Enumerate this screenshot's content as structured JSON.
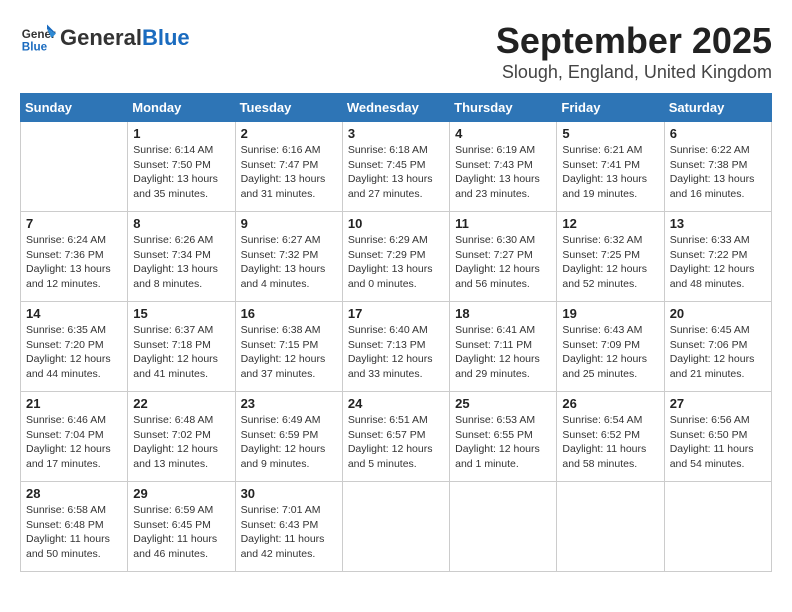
{
  "logo": {
    "general": "General",
    "blue": "Blue"
  },
  "title": "September 2025",
  "subtitle": "Slough, England, United Kingdom",
  "days": [
    "Sunday",
    "Monday",
    "Tuesday",
    "Wednesday",
    "Thursday",
    "Friday",
    "Saturday"
  ],
  "weeks": [
    [
      {
        "date": "",
        "info": ""
      },
      {
        "date": "1",
        "info": "Sunrise: 6:14 AM\nSunset: 7:50 PM\nDaylight: 13 hours\nand 35 minutes."
      },
      {
        "date": "2",
        "info": "Sunrise: 6:16 AM\nSunset: 7:47 PM\nDaylight: 13 hours\nand 31 minutes."
      },
      {
        "date": "3",
        "info": "Sunrise: 6:18 AM\nSunset: 7:45 PM\nDaylight: 13 hours\nand 27 minutes."
      },
      {
        "date": "4",
        "info": "Sunrise: 6:19 AM\nSunset: 7:43 PM\nDaylight: 13 hours\nand 23 minutes."
      },
      {
        "date": "5",
        "info": "Sunrise: 6:21 AM\nSunset: 7:41 PM\nDaylight: 13 hours\nand 19 minutes."
      },
      {
        "date": "6",
        "info": "Sunrise: 6:22 AM\nSunset: 7:38 PM\nDaylight: 13 hours\nand 16 minutes."
      }
    ],
    [
      {
        "date": "7",
        "info": "Sunrise: 6:24 AM\nSunset: 7:36 PM\nDaylight: 13 hours\nand 12 minutes."
      },
      {
        "date": "8",
        "info": "Sunrise: 6:26 AM\nSunset: 7:34 PM\nDaylight: 13 hours\nand 8 minutes."
      },
      {
        "date": "9",
        "info": "Sunrise: 6:27 AM\nSunset: 7:32 PM\nDaylight: 13 hours\nand 4 minutes."
      },
      {
        "date": "10",
        "info": "Sunrise: 6:29 AM\nSunset: 7:29 PM\nDaylight: 13 hours\nand 0 minutes."
      },
      {
        "date": "11",
        "info": "Sunrise: 6:30 AM\nSunset: 7:27 PM\nDaylight: 12 hours\nand 56 minutes."
      },
      {
        "date": "12",
        "info": "Sunrise: 6:32 AM\nSunset: 7:25 PM\nDaylight: 12 hours\nand 52 minutes."
      },
      {
        "date": "13",
        "info": "Sunrise: 6:33 AM\nSunset: 7:22 PM\nDaylight: 12 hours\nand 48 minutes."
      }
    ],
    [
      {
        "date": "14",
        "info": "Sunrise: 6:35 AM\nSunset: 7:20 PM\nDaylight: 12 hours\nand 44 minutes."
      },
      {
        "date": "15",
        "info": "Sunrise: 6:37 AM\nSunset: 7:18 PM\nDaylight: 12 hours\nand 41 minutes."
      },
      {
        "date": "16",
        "info": "Sunrise: 6:38 AM\nSunset: 7:15 PM\nDaylight: 12 hours\nand 37 minutes."
      },
      {
        "date": "17",
        "info": "Sunrise: 6:40 AM\nSunset: 7:13 PM\nDaylight: 12 hours\nand 33 minutes."
      },
      {
        "date": "18",
        "info": "Sunrise: 6:41 AM\nSunset: 7:11 PM\nDaylight: 12 hours\nand 29 minutes."
      },
      {
        "date": "19",
        "info": "Sunrise: 6:43 AM\nSunset: 7:09 PM\nDaylight: 12 hours\nand 25 minutes."
      },
      {
        "date": "20",
        "info": "Sunrise: 6:45 AM\nSunset: 7:06 PM\nDaylight: 12 hours\nand 21 minutes."
      }
    ],
    [
      {
        "date": "21",
        "info": "Sunrise: 6:46 AM\nSunset: 7:04 PM\nDaylight: 12 hours\nand 17 minutes."
      },
      {
        "date": "22",
        "info": "Sunrise: 6:48 AM\nSunset: 7:02 PM\nDaylight: 12 hours\nand 13 minutes."
      },
      {
        "date": "23",
        "info": "Sunrise: 6:49 AM\nSunset: 6:59 PM\nDaylight: 12 hours\nand 9 minutes."
      },
      {
        "date": "24",
        "info": "Sunrise: 6:51 AM\nSunset: 6:57 PM\nDaylight: 12 hours\nand 5 minutes."
      },
      {
        "date": "25",
        "info": "Sunrise: 6:53 AM\nSunset: 6:55 PM\nDaylight: 12 hours\nand 1 minute."
      },
      {
        "date": "26",
        "info": "Sunrise: 6:54 AM\nSunset: 6:52 PM\nDaylight: 11 hours\nand 58 minutes."
      },
      {
        "date": "27",
        "info": "Sunrise: 6:56 AM\nSunset: 6:50 PM\nDaylight: 11 hours\nand 54 minutes."
      }
    ],
    [
      {
        "date": "28",
        "info": "Sunrise: 6:58 AM\nSunset: 6:48 PM\nDaylight: 11 hours\nand 50 minutes."
      },
      {
        "date": "29",
        "info": "Sunrise: 6:59 AM\nSunset: 6:45 PM\nDaylight: 11 hours\nand 46 minutes."
      },
      {
        "date": "30",
        "info": "Sunrise: 7:01 AM\nSunset: 6:43 PM\nDaylight: 11 hours\nand 42 minutes."
      },
      {
        "date": "",
        "info": ""
      },
      {
        "date": "",
        "info": ""
      },
      {
        "date": "",
        "info": ""
      },
      {
        "date": "",
        "info": ""
      }
    ]
  ]
}
